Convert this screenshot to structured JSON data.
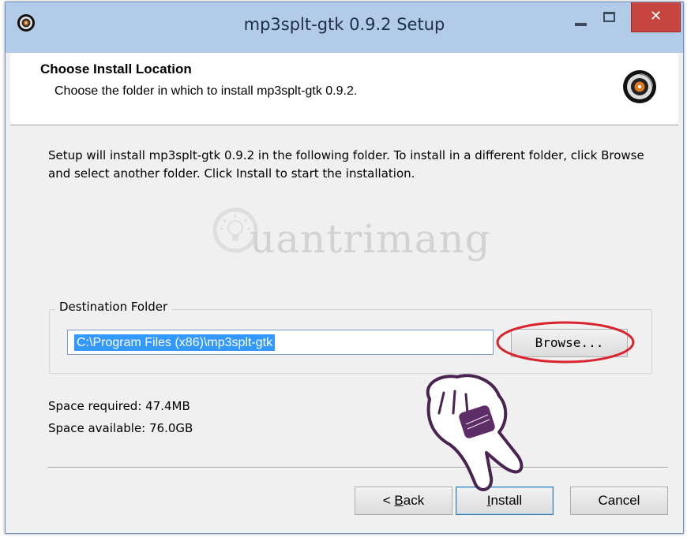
{
  "window": {
    "title": "mp3splt-gtk 0.9.2 Setup",
    "close_glyph": "✕"
  },
  "header": {
    "title": "Choose Install Location",
    "subtitle": "Choose the folder in which to install mp3splt-gtk 0.9.2."
  },
  "body": {
    "description": "Setup will install mp3splt-gtk 0.9.2 in the following folder. To install in a different folder, click Browse and select another folder. Click Install to start the installation."
  },
  "watermark": {
    "text": "uantrimang"
  },
  "destination": {
    "group_label": "Destination Folder",
    "path": "C:\\Program Files (x86)\\mp3splt-gtk",
    "browse_label": "Browse..."
  },
  "space": {
    "required": "Space required: 47.4MB",
    "available": "Space available: 76.0GB"
  },
  "buttons": {
    "back_prefix": "< ",
    "back_accel": "B",
    "back_rest": "ack",
    "install_accel": "I",
    "install_rest": "nstall",
    "cancel": "Cancel"
  },
  "icons": {
    "app": "mp3splt-disc-icon",
    "header": "mp3splt-disc-icon",
    "minimize": "minimize-icon",
    "maximize": "maximize-icon",
    "close": "close-icon",
    "annotation_hand": "pointing-hand-icon",
    "annotation_circle": "red-ellipse-highlight"
  },
  "colors": {
    "titlebar": "#b2cbe8",
    "close_button": "#c7453f",
    "selection": "#3399ff",
    "highlight_ellipse": "#d9232d"
  }
}
